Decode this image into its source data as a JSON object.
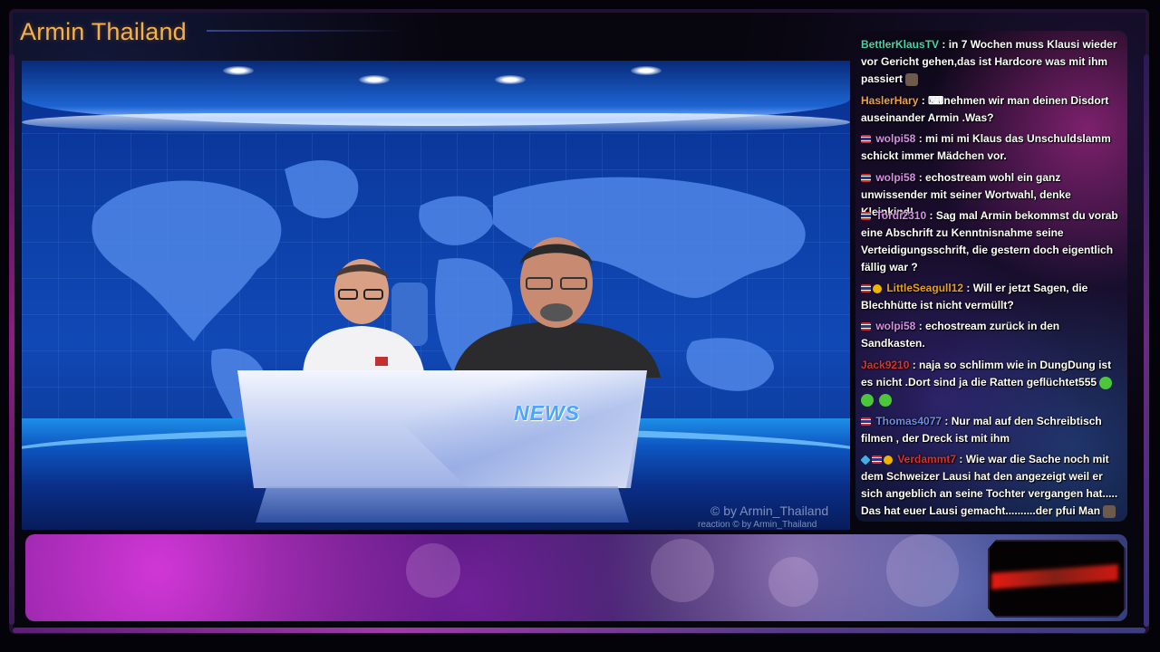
{
  "channel": {
    "title": "Armin Thailand"
  },
  "video": {
    "desk_label": "NEWS",
    "watermark": "© by Armin_Thailand",
    "watermark_small": "reaction  © by Armin_Thailand"
  },
  "chat": {
    "messages": [
      {
        "user": "BettlerKlausTV",
        "user_color": "#3fd6a8",
        "badges": [],
        "text": " : in 7 Wochen muss Klausi wieder vor Gericht gehen,das ist Hardcore was mit ihm passiert",
        "emote_after": "face-emote"
      },
      {
        "user": "HaslerHary",
        "user_color": "#f0a040",
        "badges": [],
        "text": " : ⌨nehmen wir man deinen Disdort auseinander Armin .Was?"
      },
      {
        "user": "wolpi58",
        "user_color": "#d68fe6",
        "badges": [
          "flag"
        ],
        "text": " : mi mi mi Klaus das Unschuldslamm schickt immer Mädchen vor."
      },
      {
        "user": "wolpi58",
        "user_color": "#d68fe6",
        "badges": [
          "flag"
        ],
        "text": " : echostream wohl ein ganz unwissender mit seiner Wortwahl, denke Kleinkind!"
      },
      {
        "user": "Tordi2310",
        "user_color": "#d68fe6",
        "badges": [
          "flag"
        ],
        "text": " : Sag mal Armin bekommst du vorab eine Abschrift zu Kenntnisnahme seine Verteidigungsschrift, die gestern doch eigentlich fällig war ?"
      },
      {
        "user": "LittleSeagull12",
        "user_color": "#e8a020",
        "badges": [
          "flag",
          "gold"
        ],
        "text": " : Will er jetzt Sagen, die Blechhütte ist nicht vermüllt?"
      },
      {
        "user": "wolpi58",
        "user_color": "#d68fe6",
        "badges": [
          "flag"
        ],
        "text": " : echostream zurück in den Sandkasten."
      },
      {
        "user": "Jack9210",
        "user_color": "#e03030",
        "badges": [],
        "text": " : naja so schlimm wie in DungDung ist es nicht .Dort sind ja die Ratten geflüchtet555",
        "emotes_green": 3
      },
      {
        "user": "Thomas4077",
        "user_color": "#6a8fe8",
        "badges": [
          "flag"
        ],
        "text": " : Nur mal auf den Schreibtisch filmen , der Dreck ist mit ihm"
      },
      {
        "user": "Verdammt7",
        "user_color": "#e03030",
        "badges": [
          "gem",
          "flag",
          "gold"
        ],
        "text": " : Wie war die Sache noch mit dem Schweizer Lausi hat den angezeigt weil er sich angeblich an seine Tochter vergangen hat..... Das hat euer Lausi gemacht..........der pfui Man",
        "emote_after": "face-emote"
      }
    ]
  },
  "colors": {
    "title": "#f3b24a",
    "studio_blue": "#0c3fa6",
    "banner_magenta": "#c23ad0"
  }
}
